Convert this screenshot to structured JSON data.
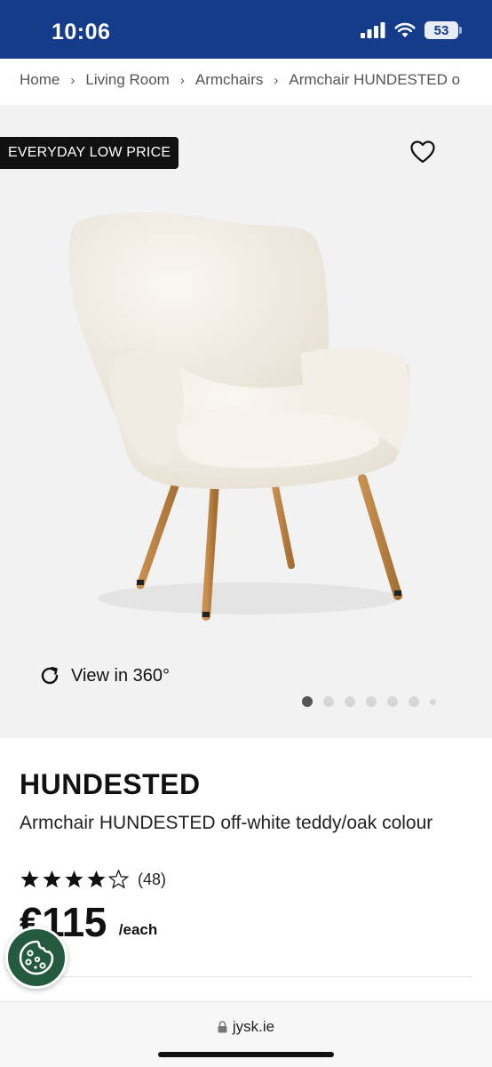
{
  "status_bar": {
    "time": "10:06",
    "battery": "53"
  },
  "breadcrumb": [
    "Home",
    "Living Room",
    "Armchairs",
    "Armchair HUNDESTED o"
  ],
  "gallery": {
    "badge": "EVERYDAY LOW PRICE",
    "view_360_label": "View in 360°",
    "image_count": 7,
    "active_image": 1
  },
  "product": {
    "name": "HUNDESTED",
    "description": "Armchair HUNDESTED off-white teddy/oak colour",
    "rating": 4,
    "rating_max": 5,
    "review_count": "(48)",
    "price": "€115",
    "price_unit": "/each"
  },
  "browser": {
    "url": "jysk.ie"
  },
  "colors": {
    "header_blue": "#143c8a",
    "cookie_green": "#245a3e"
  }
}
